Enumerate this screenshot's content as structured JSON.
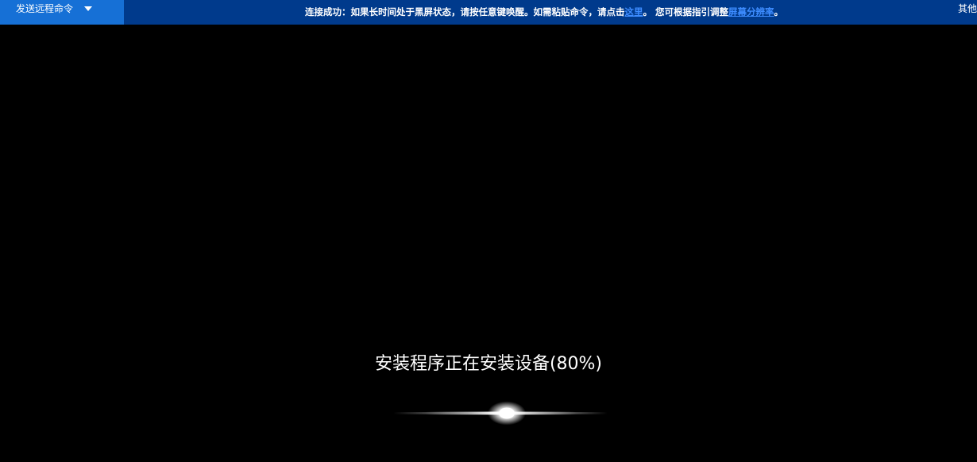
{
  "toolbar": {
    "send_command_label": "发送远程命令",
    "notice_prefix": "连接成功：如果长时间处于黑屏状态，请按任意键唤醒。如需粘贴命令，请点击",
    "notice_link_here": "这里",
    "notice_middle": "。 您可根据指引调整",
    "notice_link_resolution": "屏幕分辨率",
    "notice_suffix": "。",
    "more_label": "其他",
    "colors": {
      "bar": "#003a8c",
      "send_button": "#1670d6",
      "link": "#3d8cff"
    }
  },
  "screen": {
    "status_text": "安装程序正在安装设备(80%)",
    "progress_percent": 80,
    "icons": [
      "chevron-down-icon",
      "loading-glow-icon"
    ]
  }
}
